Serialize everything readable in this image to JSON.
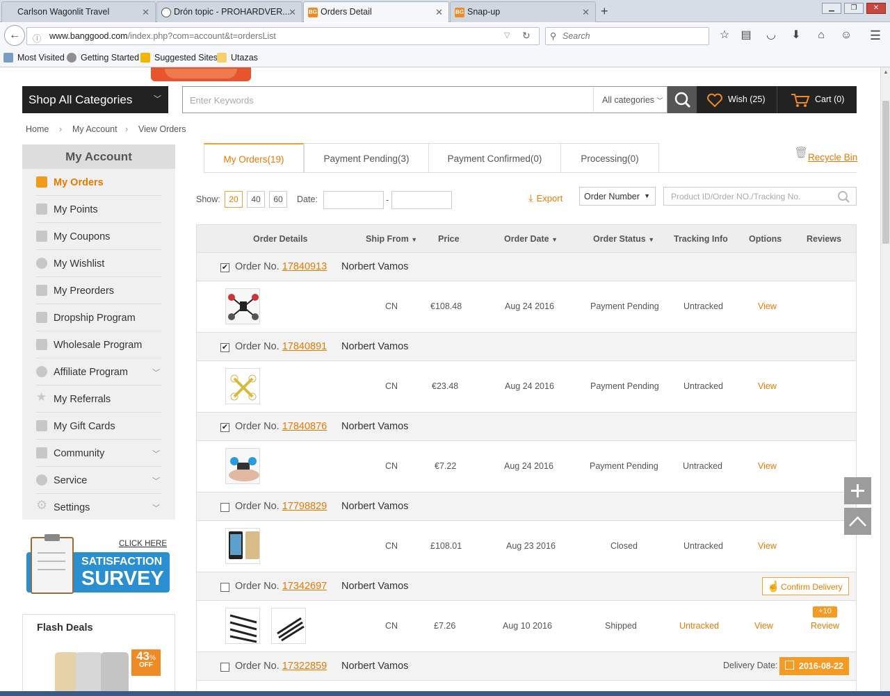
{
  "browser": {
    "tabs": [
      {
        "title": "Carlson Wagonlit Travel"
      },
      {
        "title": "Drón topic - PROHARDVER..."
      },
      {
        "title": "Orders Detail"
      },
      {
        "title": "Snap-up"
      }
    ],
    "new_tab": "+",
    "close_glyph": "✕",
    "url_domain": "www.banggood.com",
    "url_path": "/index.php?com=account&t=ordersList",
    "search_placeholder": "Search",
    "bookmarks": [
      "Most Visited",
      "Getting Started",
      "Suggested Sites",
      "Utazas"
    ]
  },
  "header": {
    "shop_all": "Shop All Categories",
    "keyword_placeholder": "Enter Keywords",
    "category_select": "All categories",
    "wish": "Wish (25)",
    "cart": "Cart (0)"
  },
  "breadcrumb": [
    "Home",
    "My Account",
    "View Orders"
  ],
  "breadcrumb_sep": "›",
  "sidebar": {
    "title": "My Account",
    "items": [
      {
        "label": "My Orders",
        "active": true
      },
      {
        "label": "My Points"
      },
      {
        "label": "My Coupons"
      },
      {
        "label": "My Wishlist"
      },
      {
        "label": "My Preorders"
      },
      {
        "label": "Dropship Program"
      },
      {
        "label": "Wholesale Program"
      },
      {
        "label": "Affiliate Program",
        "expandable": true
      },
      {
        "label": "My Referrals"
      },
      {
        "label": "My Gift Cards"
      },
      {
        "label": "Community",
        "expandable": true
      },
      {
        "label": "Service",
        "expandable": true
      },
      {
        "label": "Settings",
        "expandable": true
      }
    ],
    "survey_click": "CLICK HERE",
    "survey_line1": "SATISFACTION",
    "survey_line2": "SURVEY",
    "flash_title": "Flash Deals",
    "flash_discount": "43",
    "flash_percent": "%",
    "flash_off": "OFF"
  },
  "order_tabs": [
    {
      "label": "My Orders(19)",
      "active": true
    },
    {
      "label": "Payment Pending(3)"
    },
    {
      "label": "Payment Confirmed(0)"
    },
    {
      "label": "Processing(0)"
    }
  ],
  "recycle_bin": "Recycle Bin",
  "filters": {
    "show_label": "Show:",
    "page_sizes": [
      "20",
      "40",
      "60"
    ],
    "date_label": "Date:",
    "date_sep": "-",
    "export": "Export",
    "search_by": "Order Number",
    "search_placeholder": "Product ID/Order NO./Tracking No."
  },
  "table": {
    "headers": [
      "Order Details",
      "Ship From",
      "Price",
      "Order Date",
      "Order Status",
      "Tracking Info",
      "Options",
      "Reviews"
    ],
    "order_prefix": "Order No."
  },
  "orders": [
    {
      "number": "17840913",
      "checked": true,
      "customer": "Norbert Vamos",
      "ship_from": "CN",
      "price": "€108.48",
      "date": "Aug 24 2016",
      "status": "Payment Pending",
      "tracking": "Untracked",
      "option": "View"
    },
    {
      "number": "17840891",
      "checked": true,
      "customer": "Norbert Vamos",
      "ship_from": "CN",
      "price": "€23.48",
      "date": "Aug 24 2016",
      "status": "Payment Pending",
      "tracking": "Untracked",
      "option": "View"
    },
    {
      "number": "17840876",
      "checked": true,
      "customer": "Norbert Vamos",
      "ship_from": "CN",
      "price": "€7.22",
      "date": "Aug 24 2016",
      "status": "Payment Pending",
      "tracking": "Untracked",
      "option": "View"
    },
    {
      "number": "17798829",
      "checked": false,
      "customer": "Norbert Vamos",
      "ship_from": "CN",
      "price": "£108.01",
      "date": "Aug 23 2016",
      "status": "Closed",
      "tracking": "Untracked",
      "option": "View"
    },
    {
      "number": "17342697",
      "checked": false,
      "customer": "Norbert Vamos",
      "ship_from": "CN",
      "price": "£7.26",
      "date": "Aug 10 2016",
      "status": "Shipped",
      "tracking": "Untracked",
      "option": "View",
      "review": "Review",
      "review_badge": "+10",
      "action": "Confirm Delivery"
    },
    {
      "number": "17322859",
      "checked": false,
      "customer": "Norbert Vamos",
      "delivery_label": "Delivery Date:",
      "delivery_date": "2016-08-22"
    }
  ],
  "colors": {
    "accent": "#e87a00",
    "dark": "#222222",
    "badge": "#f59a23"
  }
}
